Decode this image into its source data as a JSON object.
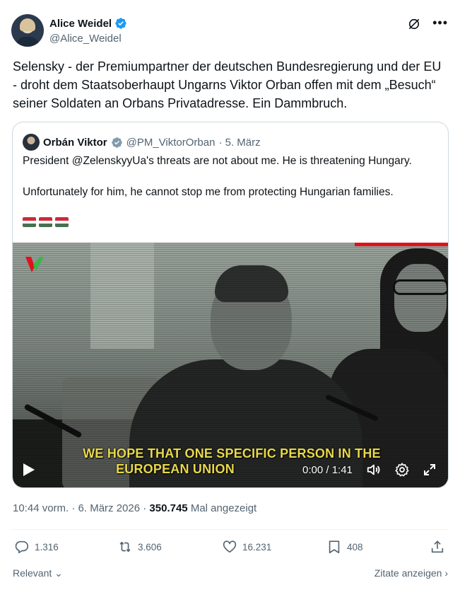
{
  "author": {
    "name": "Alice Weidel",
    "handle": "@Alice_Weidel"
  },
  "tweet_text": "Selensky - der Premiumpartner der deutschen Bundesregierung und der EU - droht dem Staatsoberhaupt Ungarns Viktor Orban offen mit dem „Besuch“ seiner Soldaten an Orbans Privatadresse. Ein Dammbruch.",
  "quote": {
    "name": "Orbán Viktor",
    "handle": "@PM_ViktorOrban",
    "date": "· 5. März",
    "text1": "President @ZelenskyyUa's threats are not about me. He is threatening Hungary.",
    "text2": "Unfortunately for him, he cannot stop me from protecting Hungarian families.",
    "flags_emoji": "🇭🇺🇭🇺🇭🇺",
    "video": {
      "subtitle_line1": "WE HOPE THAT ONE SPECIFIC PERSON IN THE",
      "subtitle_line2": "EUROPEAN UNION",
      "time": "0:00 / 1:41"
    }
  },
  "meta": {
    "timestamp": "10:44 vorm. · 6. März 2026 · ",
    "views": "350.745",
    "views_label": " Mal angezeigt"
  },
  "actions": {
    "replies": "1.316",
    "reposts": "3.606",
    "likes": "16.231",
    "bookmarks": "408"
  },
  "footer": {
    "sort_label": "Relevant",
    "quotes_label": "Zitate anzeigen"
  },
  "colors": {
    "verified": "#1d9bf0",
    "flag_red": "#ce2939",
    "flag_white": "#ffffff",
    "flag_green": "#477050",
    "subtitle": "#e8d84b"
  },
  "icons": [
    "verified-badge-icon",
    "grok-icon",
    "more-icon",
    "play-icon",
    "volume-icon",
    "settings-icon",
    "fullscreen-icon",
    "reply-icon",
    "repost-icon",
    "like-icon",
    "bookmark-icon",
    "share-icon",
    "chevron-down-icon",
    "chevron-right-icon"
  ]
}
